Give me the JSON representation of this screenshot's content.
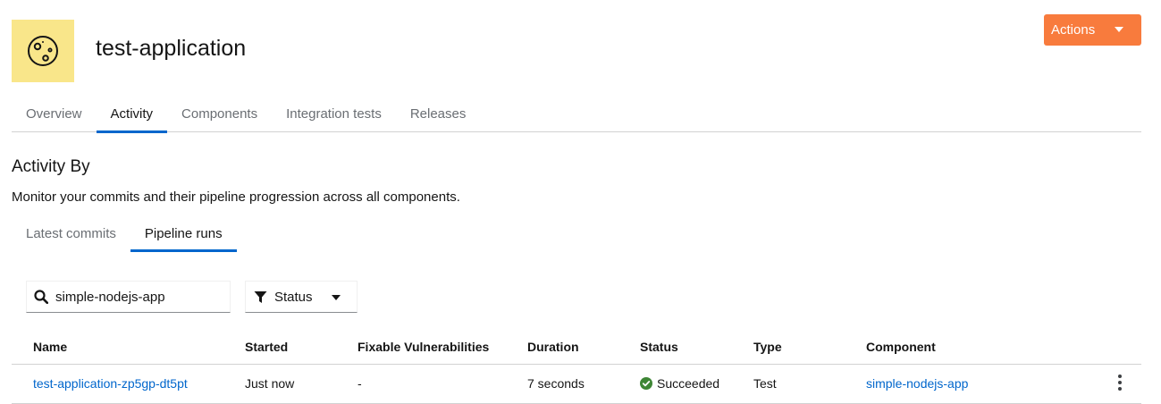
{
  "app": {
    "title": "test-application",
    "icon": "planet-icon",
    "icon_bg": "#f9e68a"
  },
  "header": {
    "actions_label": "Actions",
    "actions_color": "#f87b3d"
  },
  "main_tabs": [
    {
      "label": "Overview",
      "active": false
    },
    {
      "label": "Activity",
      "active": true
    },
    {
      "label": "Components",
      "active": false
    },
    {
      "label": "Integration tests",
      "active": false
    },
    {
      "label": "Releases",
      "active": false
    }
  ],
  "activity": {
    "title": "Activity By",
    "description": "Monitor your commits and their pipeline progression across all components.",
    "sub_tabs": [
      {
        "label": "Latest commits",
        "active": false
      },
      {
        "label": "Pipeline runs",
        "active": true
      }
    ]
  },
  "filters": {
    "search_value": "simple-nodejs-app",
    "status_label": "Status"
  },
  "table": {
    "columns": [
      "Name",
      "Started",
      "Fixable Vulnerabilities",
      "Duration",
      "Status",
      "Type",
      "Component"
    ],
    "rows": [
      {
        "name": "test-application-zp5gp-dt5pt",
        "started": "Just now",
        "vulnerabilities": "-",
        "duration": "7 seconds",
        "status": "Succeeded",
        "type": "Test",
        "component": "simple-nodejs-app"
      }
    ]
  },
  "colors": {
    "link": "#0066cc",
    "success": "#3e8635",
    "tab_active_border": "#0066cc"
  }
}
